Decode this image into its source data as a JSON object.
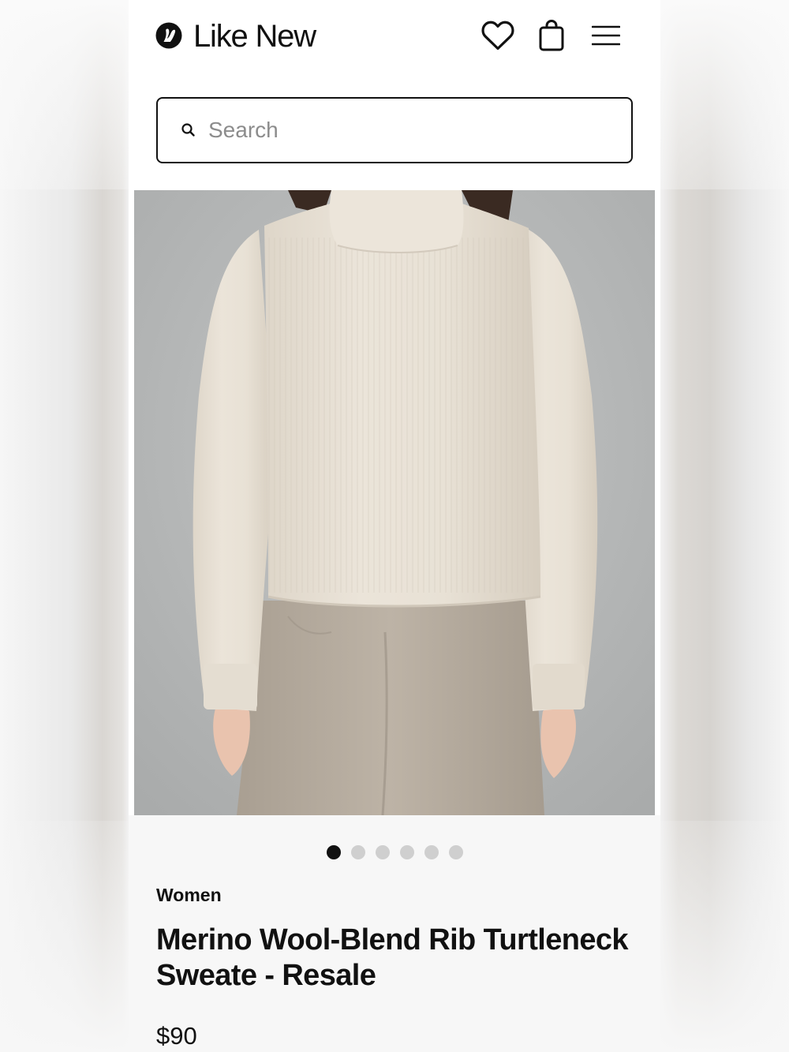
{
  "header": {
    "brand_name": "Like New",
    "icons": [
      "lululemon-logo-icon",
      "heart-icon",
      "shopping-bag-icon",
      "menu-icon"
    ]
  },
  "search": {
    "placeholder": "Search",
    "value": ""
  },
  "gallery": {
    "image_count": 6,
    "active_index": 0
  },
  "product": {
    "category": "Women",
    "title": "Merino Wool-Blend Rib Turtleneck Sweate - Resale",
    "price": "$90"
  },
  "colors": {
    "text": "#111111",
    "background": "#ffffff",
    "dot_inactive": "#cfcfcf",
    "dot_active": "#111111"
  }
}
